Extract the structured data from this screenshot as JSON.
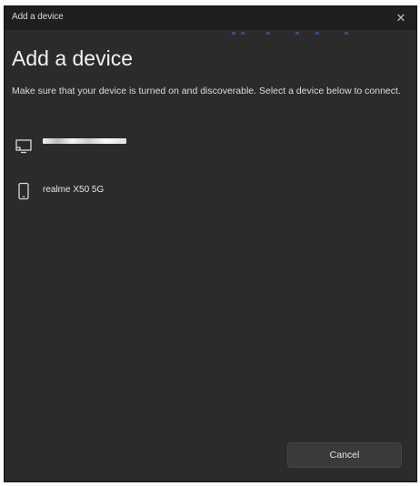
{
  "window": {
    "title": "Add a device",
    "close_glyph": "✕"
  },
  "dialog": {
    "heading": "Add a device",
    "description": "Make sure that your device is turned on and discoverable. Select a device below to connect."
  },
  "devices": [
    {
      "icon": "monitor-icon",
      "name": ""
    },
    {
      "icon": "phone-icon",
      "name": "realme X50 5G"
    }
  ],
  "footer": {
    "cancel_label": "Cancel"
  },
  "colors": {
    "window_bg": "#2b2b2b",
    "titlebar_bg": "#1f1f1f",
    "text": "#f2f2f2",
    "button_bg": "#3a3a3a"
  }
}
